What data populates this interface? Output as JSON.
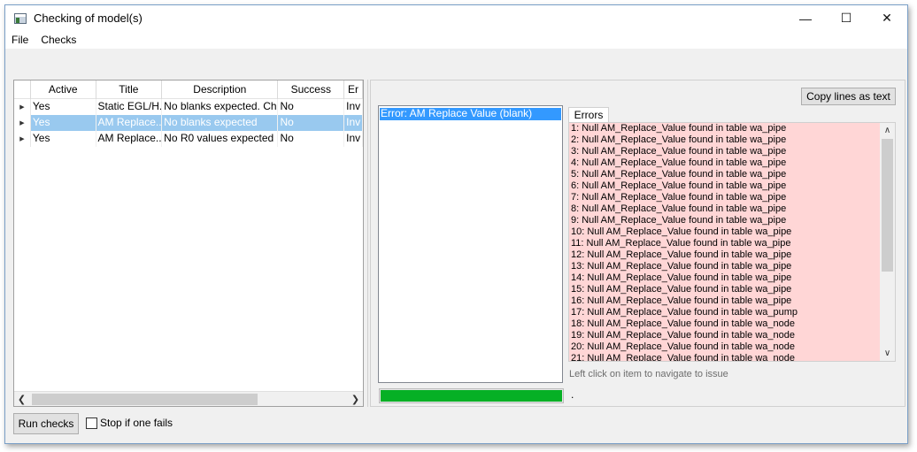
{
  "window": {
    "title": "Checking of model(s)"
  },
  "menu": {
    "file": "File",
    "checks": "Checks"
  },
  "grid": {
    "headers": {
      "active": "Active",
      "title": "Title",
      "description": "Description",
      "success": "Success",
      "errors": "Er"
    },
    "rows": [
      {
        "active": "Yes",
        "title": "Static EGL/H...",
        "description": "No blanks expected. Ch...",
        "success": "No",
        "errors": "Inv"
      },
      {
        "active": "Yes",
        "title": "AM Replace...",
        "description": "No blanks expected",
        "success": "No",
        "errors": "Inv"
      },
      {
        "active": "Yes",
        "title": "AM Replace...",
        "description": "No R0 values expected",
        "success": "No",
        "errors": "Inv"
      }
    ]
  },
  "copy_button": "Copy lines as text",
  "error_list": {
    "items": [
      "Error: AM Replace Value (blank)"
    ]
  },
  "errors_tab": "Errors",
  "error_lines": [
    "1: Null AM_Replace_Value found in table wa_pipe",
    "2: Null AM_Replace_Value found in table wa_pipe",
    "3: Null AM_Replace_Value found in table wa_pipe",
    "4: Null AM_Replace_Value found in table wa_pipe",
    "5: Null AM_Replace_Value found in table wa_pipe",
    "6: Null AM_Replace_Value found in table wa_pipe",
    "7: Null AM_Replace_Value found in table wa_pipe",
    "8: Null AM_Replace_Value found in table wa_pipe",
    "9: Null AM_Replace_Value found in table wa_pipe",
    "10: Null AM_Replace_Value found in table wa_pipe",
    "11: Null AM_Replace_Value found in table wa_pipe",
    "12: Null AM_Replace_Value found in table wa_pipe",
    "13: Null AM_Replace_Value found in table wa_pipe",
    "14: Null AM_Replace_Value found in table wa_pipe",
    "15: Null AM_Replace_Value found in table wa_pipe",
    "16: Null AM_Replace_Value found in table wa_pipe",
    "17: Null AM_Replace_Value found in table wa_pump",
    "18: Null AM_Replace_Value found in table wa_node",
    "19: Null AM_Replace_Value found in table wa_node",
    "20: Null AM_Replace_Value found in table wa_node",
    "21: Null AM_Replace_Value found in table wa_node"
  ],
  "hint": "Left click on item to navigate to issue",
  "progress": {
    "value": 1.0,
    "label": "."
  },
  "bottom": {
    "run_button": "Run checks",
    "stop_label": "Stop if one fails"
  },
  "colors": {
    "selection": "#99c9ef",
    "list_selection": "#3399ff",
    "error_bg": "#ffd6d6",
    "progress": "#06b025"
  },
  "icons": {
    "minimize": "minimize-icon",
    "maximize": "maximize-icon",
    "close": "close-icon"
  }
}
